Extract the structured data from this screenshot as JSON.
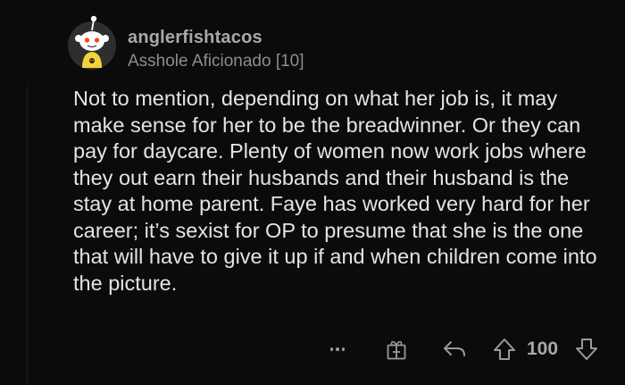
{
  "comment": {
    "author": "anglerfishtacos",
    "flair": "Asshole Aficionado [10]",
    "body": "Not to mention, depending on what her job is, it may make sense for her to be the breadwinner. Or they can pay for daycare. Plenty of women now work jobs where they out earn their husbands and their husband is the stay at home parent. Faye has worked very hard for her career; it’s sexist for OP to presume that she is the one that will have to give it up if and when children come into the picture.",
    "vote_count": "100"
  },
  "icons": {
    "avatar": "snoo-avatar",
    "more": "more-dots-icon",
    "award": "award-gift-icon",
    "reply": "reply-arrow-icon",
    "upvote": "upvote-arrow-icon",
    "downvote": "downvote-arrow-icon"
  },
  "colors": {
    "background": "#0b0b0b",
    "text": "#e4e4e6",
    "muted": "#8d8d90",
    "avatar_bg": "#2e2e30",
    "snoo_shirt": "#f2d33a"
  }
}
